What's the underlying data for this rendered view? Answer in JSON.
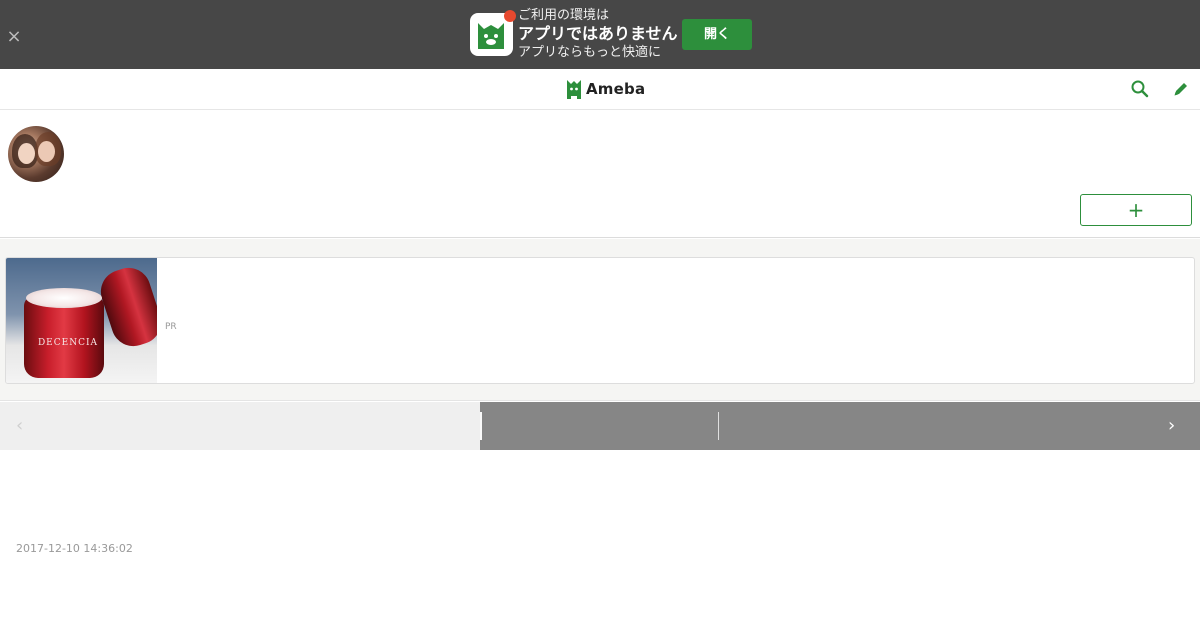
{
  "app_banner": {
    "close_label": "×",
    "line1": "ご利用の環境は",
    "line2": "アプリではありません",
    "line3": "アプリならもっと快適に",
    "open_button": "開く",
    "icon": "ameba-app-icon",
    "accent": "#2d8f3c",
    "dot_color": "#e8492f"
  },
  "header": {
    "logo_text": "Ameba",
    "search_icon": "search-icon",
    "edit_icon": "pencil-icon"
  },
  "profile": {
    "blog_title": "",
    "follow_label": "+"
  },
  "ad": {
    "pr_label": "PR",
    "product_label": "DECENCIA"
  },
  "pager": {
    "prev_icon": "‹",
    "next_icon": "›"
  },
  "post": {
    "timestamp": "2017-12-10 14:36:02"
  }
}
